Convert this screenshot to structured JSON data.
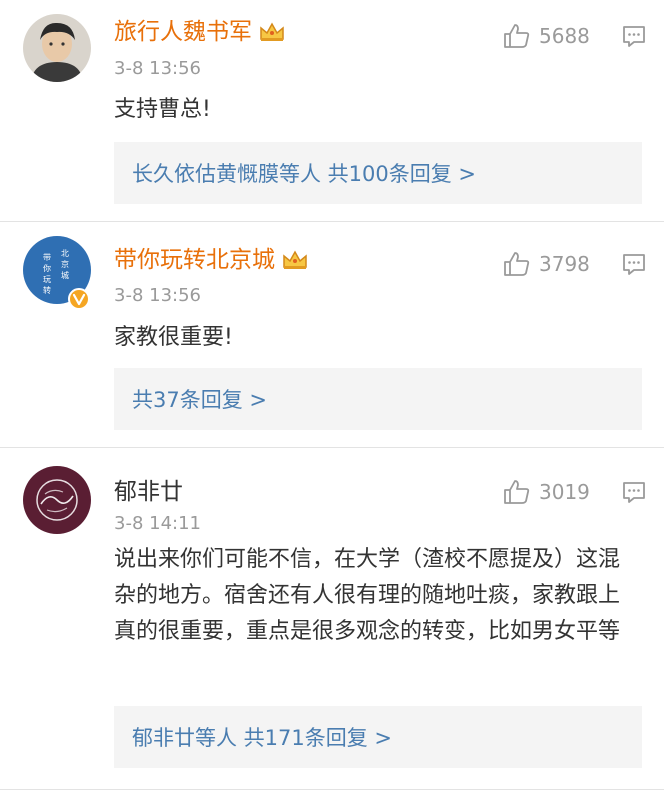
{
  "comments": [
    {
      "username": "旅行人魏书军",
      "time": "3-8 13:56",
      "likes": "5688",
      "text": "支持曹总!",
      "reply_summary": "长久依估黄慨膜等人  共100条回复 >",
      "vip": true,
      "verified": false
    },
    {
      "username": "带你玩转北京城",
      "time": "3-8 13:56",
      "likes": "3798",
      "text": "家教很重要!",
      "reply_summary": "共37条回复 >",
      "vip": true,
      "verified": true,
      "avatar_text": [
        "带",
        "你",
        "玩",
        "转",
        "北",
        "京",
        "城"
      ]
    },
    {
      "username": "郁非廿",
      "time": "3-8 14:11",
      "likes": "3019",
      "text": "说出来你们可能不信，在大学（渣校不愿提及）这混杂的地方。宿舍还有人很有理的随地吐痰，家教跟上真的很重要，重点是很多观念的转变，比如男女平等",
      "reply_summary": "郁非廿等人  共171条回复 >",
      "vip": false,
      "verified": false
    }
  ],
  "colors": {
    "vip_name": "#e8700a",
    "link": "#4a7db0",
    "muted": "#9a9a9a",
    "reply_bg": "#f4f4f4",
    "verified_badge": "#f5a623"
  },
  "icons": {
    "like": "thumbs-up-icon",
    "comment": "comment-bubble-icon",
    "crown": "vip-crown-icon",
    "verified": "verified-v-icon"
  }
}
